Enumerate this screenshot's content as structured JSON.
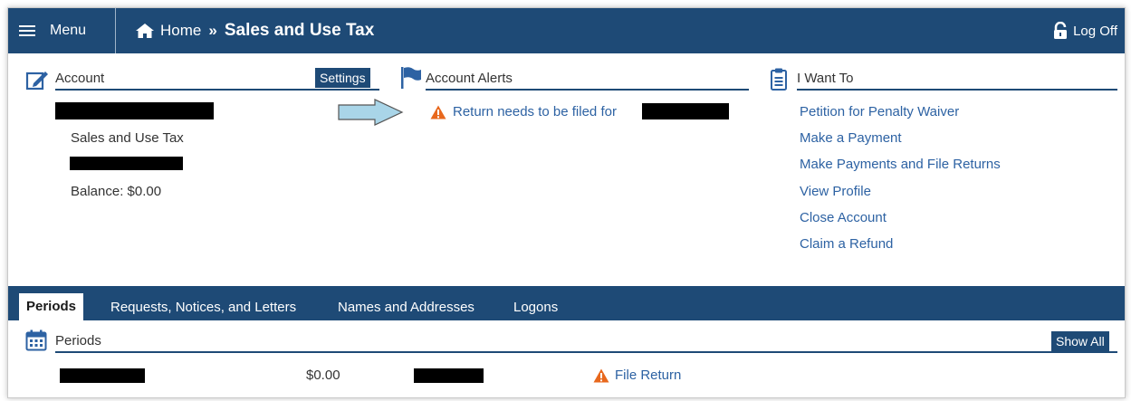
{
  "topbar": {
    "menu_label": "Menu",
    "home_label": "Home",
    "separator": "»",
    "current_page": "Sales and Use Tax",
    "logoff_label": "Log Off"
  },
  "account": {
    "heading": "Account",
    "settings_label": "Settings",
    "tax_type": "Sales and Use Tax",
    "balance": "Balance: $0.00"
  },
  "alerts": {
    "heading": "Account Alerts",
    "alert_text": "Return needs to be filed for"
  },
  "i_want_to": {
    "heading": "I Want To",
    "links": [
      "Petition for Penalty Waiver",
      "Make a Payment",
      "Make Payments and File Returns",
      "View Profile",
      "Close Account",
      "Claim a Refund"
    ]
  },
  "tabs": [
    "Periods",
    "Requests, Notices, and Letters",
    "Names and Addresses",
    "Logons"
  ],
  "periods": {
    "heading": "Periods",
    "show_all_label": "Show All",
    "row": {
      "amount": "$0.00",
      "action": "File Return"
    }
  },
  "colors": {
    "navy": "#1e4a76",
    "link": "#2d62a3",
    "warning": "#e8681d",
    "arrow_fill": "#a9d5e8"
  },
  "icons": [
    "hamburger-icon",
    "home-icon",
    "lock-icon",
    "edit-icon",
    "flag-icon",
    "clipboard-icon",
    "warning-icon",
    "calendar-icon",
    "arrow-icon"
  ]
}
